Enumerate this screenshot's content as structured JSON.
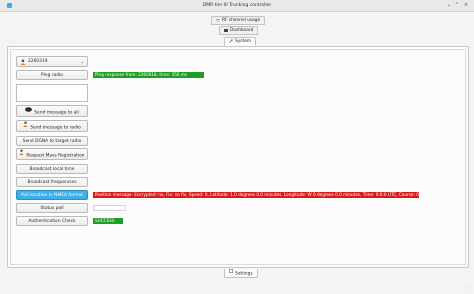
{
  "window": {
    "title": "DMR tier III Trunking controller"
  },
  "top_tabs": [
    {
      "label": "RF channel usage",
      "icon": "wifi-signal-icon"
    },
    {
      "label": "Dashboard",
      "icon": "dashboard-icon"
    },
    {
      "label": "System",
      "icon": "wrench-icon",
      "selected": true
    }
  ],
  "radio_selector": {
    "value": "2260319",
    "icon": "user-icon"
  },
  "buttons": {
    "ping": "Ping radio",
    "send_all": "Send message to all",
    "send_radio": "Send message to radio",
    "send_dgna": "Send DGNA to target radio",
    "mass_reg": "Request Mass Registration",
    "broadcast_time": "Broadcast local time",
    "broadcast_freq": "Broadcast frequencies",
    "poll_location": "Poll location in NMEA format",
    "status_poll": "Status poll",
    "auth_check": "Authentication Check"
  },
  "statuses": {
    "ping": "Ping response from: 2260018, time: 356 ms",
    "location": "Position message: Encrypted: no, Fix: no fix, Speed: 0, Latitude: 1.0 degrees 0.0 minutes, Longitude: W 0 degrees 0.0 minutes, Time: 0:0:0 UTC, Course: 0 degrees",
    "status_poll": "",
    "auth": "SUCCESS"
  },
  "bottom_tabs": [
    {
      "label": "Settings",
      "icon": "settings-icon"
    }
  ],
  "colors": {
    "accent": "#3daee9",
    "success": "#1d9d25",
    "error": "#d61b1b"
  }
}
